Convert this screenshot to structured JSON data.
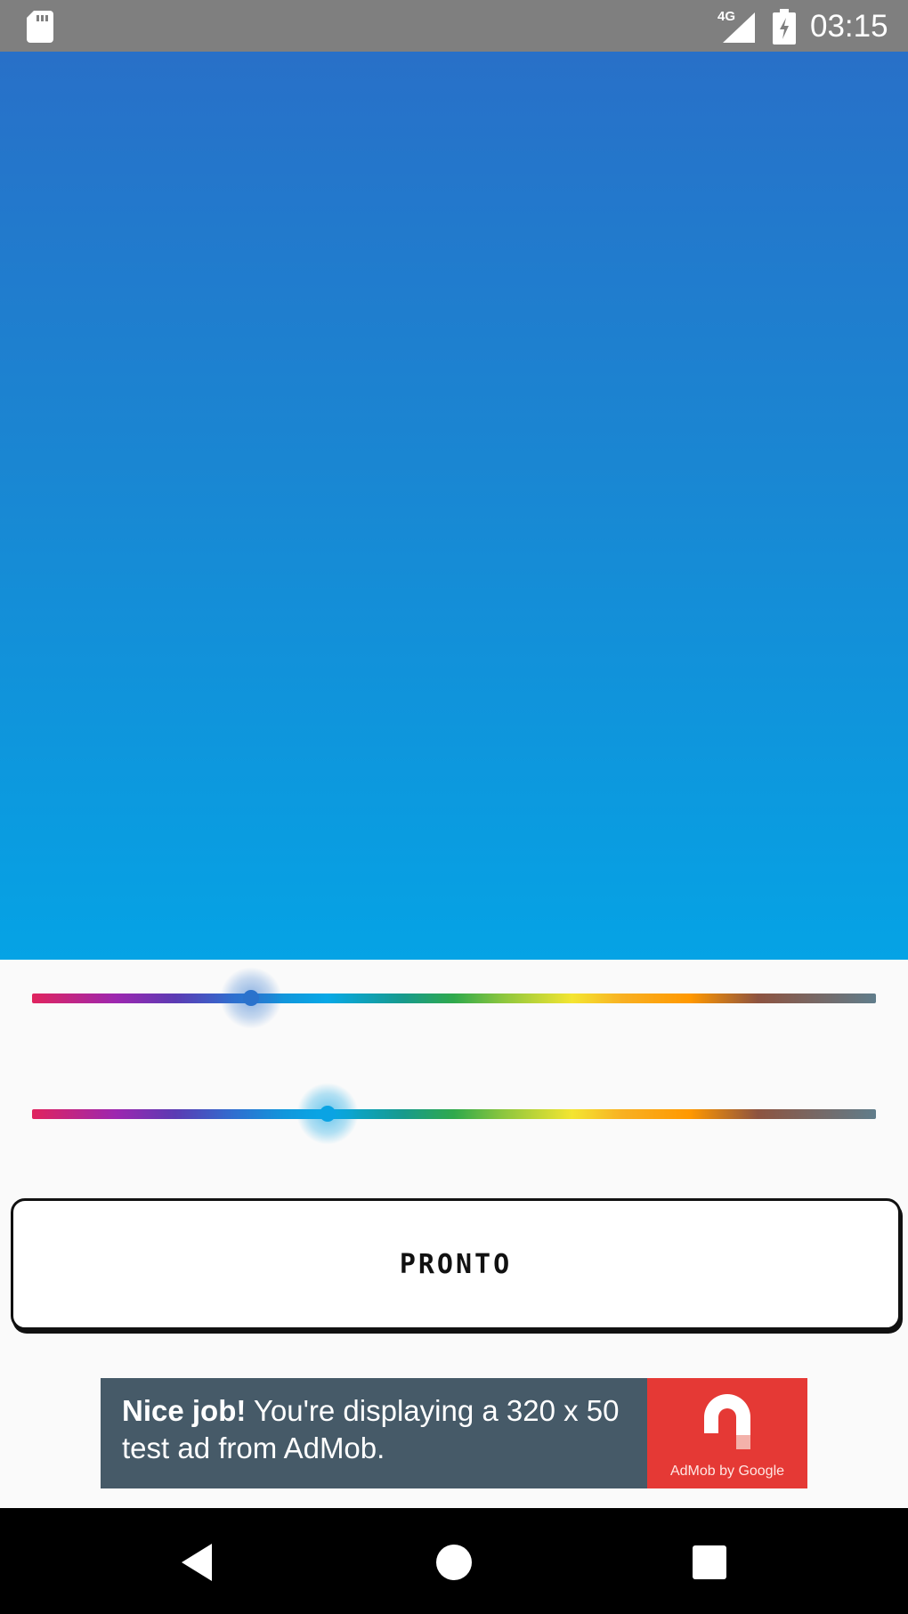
{
  "status_bar": {
    "network": "4G",
    "time": "03:15",
    "icons": [
      "sd-card-icon",
      "signal-icon",
      "battery-charging-icon"
    ]
  },
  "preview": {
    "top_color": "#2870c8",
    "bottom_color": "#05a3e5"
  },
  "sliders": [
    {
      "name": "slider-1",
      "value_fraction": 0.26,
      "thumb_color": "#2a72cc"
    },
    {
      "name": "slider-2",
      "value_fraction": 0.35,
      "thumb_color": "#0aa3e3"
    }
  ],
  "button": {
    "label": "PRONTO"
  },
  "ad": {
    "bold": "Nice job!",
    "text": " You're displaying a 320 x 50 test ad from AdMob.",
    "brand": "AdMob by Google",
    "brand_color": "#e53935",
    "background_color": "#465a68"
  },
  "nav_bar": {
    "icons": [
      "back-icon",
      "home-icon",
      "recents-icon"
    ]
  }
}
